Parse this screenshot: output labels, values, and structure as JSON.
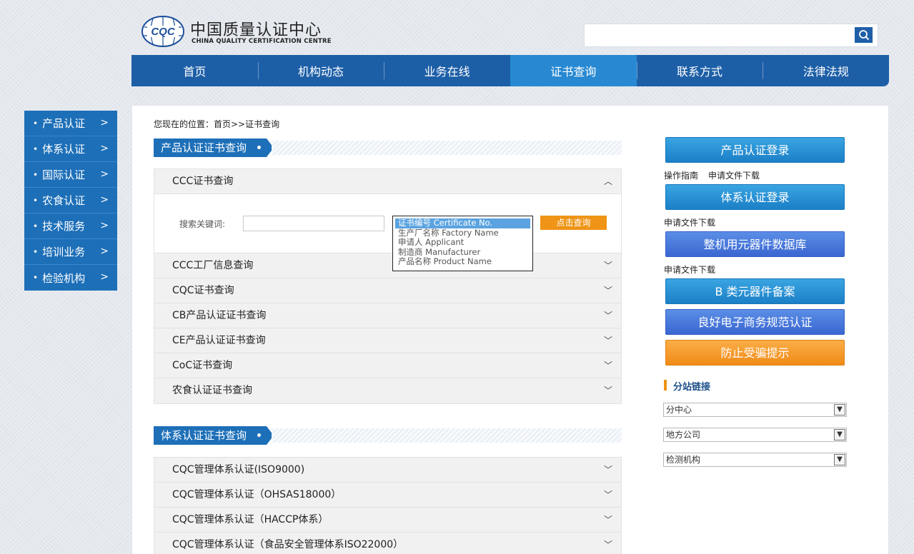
{
  "header": {
    "logo_mark_text": "CQC",
    "logo_cn": "中国质量认证中心",
    "logo_en": "CHINA QUALITY CERTIFICATION CENTRE",
    "search_placeholder": ""
  },
  "nav": {
    "items": [
      {
        "label": "首页"
      },
      {
        "label": "机构动态"
      },
      {
        "label": "业务在线"
      },
      {
        "label": "证书查询"
      },
      {
        "label": "联系方式"
      },
      {
        "label": "法律法规"
      }
    ],
    "active": "证书查询"
  },
  "sidebar": {
    "items": [
      {
        "label": "产品认证"
      },
      {
        "label": "体系认证"
      },
      {
        "label": "国际认证"
      },
      {
        "label": "农食认证"
      },
      {
        "label": "技术服务"
      },
      {
        "label": "培训业务"
      },
      {
        "label": "检验机构"
      }
    ]
  },
  "breadcrumb": "您现在的位置：首页>>证书查询",
  "product_section": {
    "title": "产品认证证书查询",
    "expanded_item": "CCC证书查询",
    "search": {
      "keyword_label": "搜索关键词:",
      "keyword_value": "",
      "options": [
        "证书编号 Certificate No.",
        "生产厂名称 Factory Name",
        "申请人 Applicant",
        "制造商 Manufacturer",
        "产品名称 Product Name"
      ],
      "selected_option": "证书编号 Certificate No.",
      "button_label": "点击查询"
    },
    "items": [
      "CCC工厂信息查询",
      "CQC证书查询",
      "CB产品认证证书查询",
      "CE产品认证证书查询",
      "CoC证书查询",
      "农食认证证书查询"
    ]
  },
  "system_section": {
    "title": "体系认证证书查询",
    "items": [
      "CQC管理体系认证(ISO9000)",
      "CQC管理体系认证（OHSAS18000）",
      "CQC管理体系认证（HACCP体系）",
      "CQC管理体系认证（食品安全管理体系ISO22000）"
    ]
  },
  "right": {
    "buttons": [
      {
        "label": "产品认证登录"
      },
      {
        "label": "体系认证登录"
      },
      {
        "label": "整机用元器件数据库"
      },
      {
        "label": "B 类元器件备案"
      },
      {
        "label": "良好电子商务规范认证"
      },
      {
        "label": "防止受骗提示"
      }
    ],
    "links1": [
      "操作指南",
      "申请文件下载"
    ],
    "links2": [
      "申请文件下载"
    ],
    "links3": [
      "申请文件下载"
    ],
    "branch_title": "分站链接",
    "selects": [
      "分中心",
      "地方公司",
      "检测机构"
    ]
  },
  "colors": {
    "nav_blue": "#1d5fa7",
    "nav_active": "#2889d2",
    "sidebar_blue": "#1d6fb8",
    "query_orange": "#ef9416",
    "listbox_selected": "#5ba3e0"
  },
  "icons": {
    "search": "search-icon",
    "chevron_right": "chevron-right-icon",
    "chevron_down": "chevron-down-icon",
    "chevron_up": "chevron-up-icon"
  }
}
